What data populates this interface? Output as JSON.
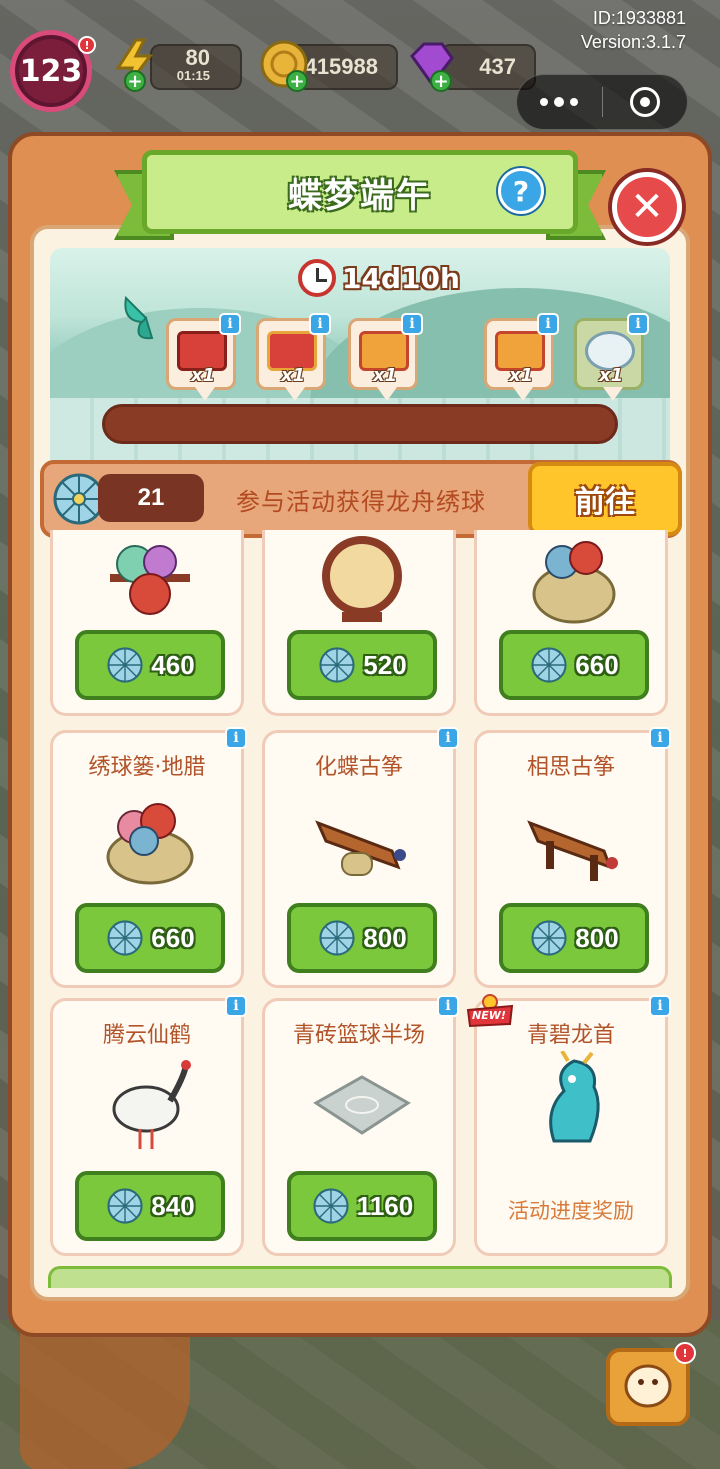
{
  "hud": {
    "level": "123",
    "energy_value": "80",
    "energy_timer": "01:15",
    "coins": "415988",
    "gems": "437",
    "level_badge": "!",
    "id_text": "ID:1933881",
    "version_text": "Version:3.1.7"
  },
  "panel": {
    "title": "蝶梦端午",
    "help_label": "?",
    "close_label": "✕"
  },
  "event": {
    "countdown": "14d10h",
    "milestone_rewards": [
      {
        "count": "x1",
        "icon": "red-chest-icon"
      },
      {
        "count": "x1",
        "icon": "ornate-chest-icon"
      },
      {
        "count": "x1",
        "icon": "gift-box-icon"
      },
      {
        "count": "x1",
        "icon": "gift-box-icon"
      },
      {
        "count": "x1",
        "icon": "penguin-icon"
      }
    ]
  },
  "currency_row": {
    "balance": "21",
    "hint": "参与活动获得龙舟绣球",
    "goto_label": "前往"
  },
  "shop": {
    "items": [
      {
        "name": "",
        "price": "460",
        "icon": "lantern-rack-icon"
      },
      {
        "name": "",
        "price": "520",
        "icon": "round-screen-icon"
      },
      {
        "name": "",
        "price": "660",
        "icon": "ball-basket-icon"
      },
      {
        "name": "绣球篓·地腊",
        "price": "660",
        "icon": "ball-basket-icon"
      },
      {
        "name": "化蝶古筝",
        "price": "800",
        "icon": "guzheng-icon"
      },
      {
        "name": "相思古筝",
        "price": "800",
        "icon": "guzheng-icon"
      },
      {
        "name": "腾云仙鹤",
        "price": "840",
        "icon": "crane-icon"
      },
      {
        "name": "青砖篮球半场",
        "price": "1160",
        "icon": "basketball-court-icon"
      },
      {
        "name": "青碧龙首",
        "price": "",
        "reward_text": "活动进度奖励",
        "icon": "dragon-head-icon",
        "badge": "NEW!"
      }
    ],
    "info_label": "i"
  },
  "colors": {
    "panel": "#e08f52",
    "green_button": "#7cc83c",
    "gold_button": "#ffc52a",
    "info_blue": "#3aa6e6"
  }
}
